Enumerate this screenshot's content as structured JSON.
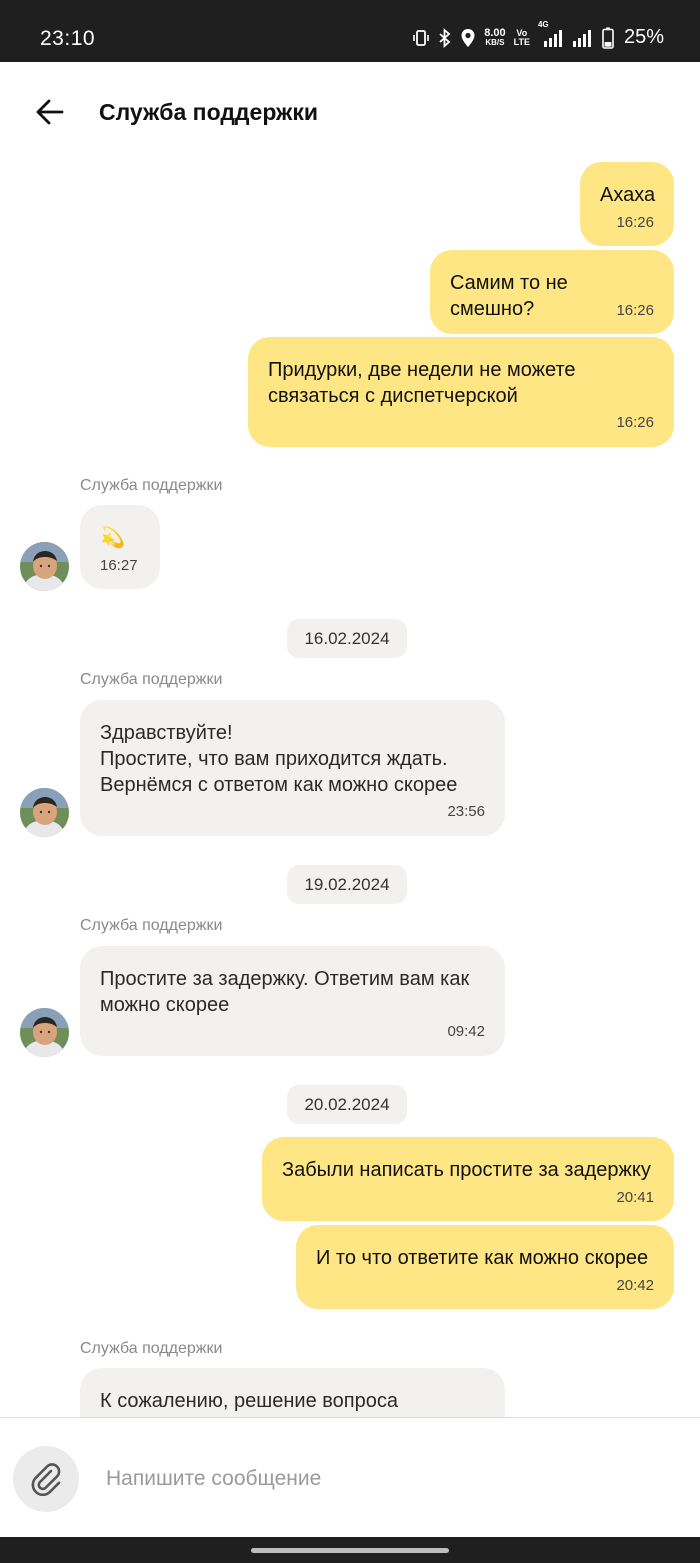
{
  "status_bar": {
    "time": "23:10",
    "net_speed_value": "8.00",
    "net_speed_unit": "KB/S",
    "volte_top": "Vo",
    "volte_bottom": "LTE",
    "network": "4G",
    "battery": "25%"
  },
  "header": {
    "title": "Служба поддержки"
  },
  "messages": [
    {
      "dir": "out",
      "text": "Ахаха",
      "time": "16:26"
    },
    {
      "dir": "out",
      "text": "Самим то не смешно?",
      "time": "16:26"
    },
    {
      "dir": "out",
      "text": "Придурки, две недели не можете\nсвязаться с диспетчерской",
      "time": "16:26"
    },
    {
      "dir": "in",
      "sender": "Служба поддержки",
      "text": "💫",
      "time": "16:27"
    },
    {
      "date": "16.02.2024"
    },
    {
      "dir": "in",
      "sender": "Служба поддержки",
      "text": "Здравствуйте!\nПростите, что вам приходится ждать.\nВернёмся с ответом как можно скорее",
      "time": "23:56"
    },
    {
      "date": "19.02.2024"
    },
    {
      "dir": "in",
      "sender": "Служба поддержки",
      "text": "Простите за задержку. Ответим вам как\nможно скорее",
      "time": "09:42"
    },
    {
      "date": "20.02.2024"
    },
    {
      "dir": "out",
      "text": "Забыли написать простите за задержку",
      "time": "20:41"
    },
    {
      "dir": "out",
      "text": "И то что ответите как можно скорее",
      "time": "20:42"
    },
    {
      "dir": "in",
      "sender": "Служба поддержки",
      "text": "К сожалению, решение вопроса"
    }
  ],
  "composer": {
    "placeholder": "Напишите сообщение"
  },
  "colors": {
    "outgoing_bubble": "#fde683",
    "incoming_bubble": "#f2f1ef",
    "status_bar": "#1f1f1f"
  }
}
